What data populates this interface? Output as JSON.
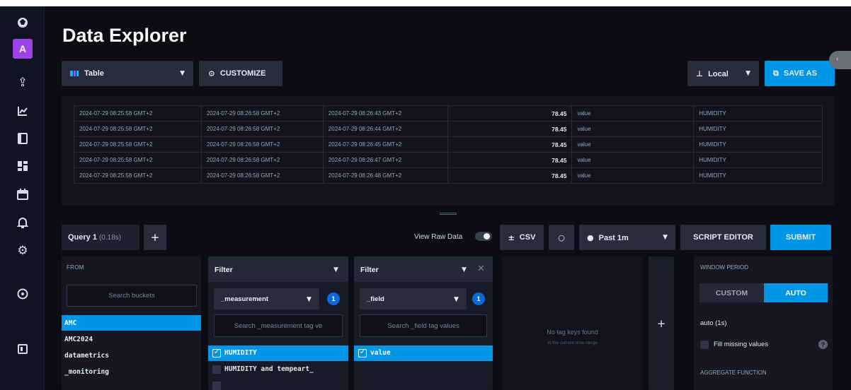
{
  "nav": {
    "avatar_letter": "A",
    "icons": [
      "logo-icon",
      "upload-icon",
      "graph-icon",
      "book-icon",
      "dashboard-icon",
      "calendar-icon",
      "bell-icon",
      "gear-icon",
      "help-icon",
      "collapse-icon"
    ]
  },
  "page": {
    "title": "Data Explorer"
  },
  "toolbar": {
    "viz_type": "Table",
    "customize_label": "CUSTOMIZE",
    "timezone": "Local",
    "save_as_label": "SAVE AS"
  },
  "results": {
    "rows": [
      [
        "2024-07-29 08:25:58 GMT+2",
        "2024-07-29 08:26:58 GMT+2",
        "2024-07-29 08:26:43 GMT+2",
        "78.45",
        "value",
        "HUMIDITY"
      ],
      [
        "2024-07-29 08:25:58 GMT+2",
        "2024-07-29 08:26:58 GMT+2",
        "2024-07-29 08:26:44 GMT+2",
        "78.45",
        "value",
        "HUMIDITY"
      ],
      [
        "2024-07-29 08:25:58 GMT+2",
        "2024-07-29 08:26:58 GMT+2",
        "2024-07-29 08:26:45 GMT+2",
        "78.45",
        "value",
        "HUMIDITY"
      ],
      [
        "2024-07-29 08:25:58 GMT+2",
        "2024-07-29 08:26:58 GMT+2",
        "2024-07-29 08:26:47 GMT+2",
        "78.45",
        "value",
        "HUMIDITY"
      ],
      [
        "2024-07-29 08:25:58 GMT+2",
        "2024-07-29 08:26:58 GMT+2",
        "2024-07-29 08:26:48 GMT+2",
        "78.45",
        "value",
        "HUMIDITY"
      ]
    ]
  },
  "query": {
    "tab_label": "Query 1",
    "tab_time": "(0.18s)",
    "add_label": "+",
    "view_raw_label": "View Raw Data",
    "view_raw_on": false,
    "csv_label": "CSV",
    "time_range": "Past 1m",
    "script_editor_label": "SCRIPT EDITOR",
    "submit_label": "SUBMIT"
  },
  "from": {
    "title": "FROM",
    "search_placeholder": "Search buckets",
    "buckets": [
      {
        "name": "AMC",
        "selected": true
      },
      {
        "name": "AMC2024",
        "selected": false
      },
      {
        "name": "datametrics",
        "selected": false
      },
      {
        "name": "_monitoring",
        "selected": false
      }
    ]
  },
  "filter1": {
    "title": "Filter",
    "key": "_measurement",
    "count": "1",
    "search_placeholder": "Search _measurement tag ve",
    "tags": [
      {
        "label": "HUMIDITY",
        "checked": true
      },
      {
        "label": "HUMIDITY and tempeart_",
        "checked": false
      }
    ]
  },
  "filter2": {
    "title": "Filter",
    "key": "_field",
    "count": "1",
    "search_placeholder": "Search _field tag values",
    "tags": [
      {
        "label": "value",
        "checked": true
      }
    ]
  },
  "empty": {
    "title": "No tag keys found",
    "subtitle": "in the current time range",
    "add_label": "+"
  },
  "window": {
    "title": "WINDOW PERIOD",
    "custom_label": "CUSTOM",
    "auto_label": "AUTO",
    "auto_value": "auto (1s)",
    "fill_label": "Fill missing values",
    "help": "?",
    "aggregate_title": "AGGREGATE FUNCTION"
  },
  "colors": {
    "accent": "#0096e6",
    "avatar": "#9b43e8",
    "badge": "#0d67d6"
  }
}
